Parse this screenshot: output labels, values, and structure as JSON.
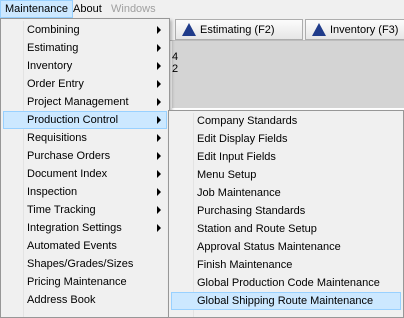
{
  "menubar": {
    "items": [
      {
        "label": "Maintenance",
        "state": "open"
      },
      {
        "label": "About",
        "state": "normal"
      },
      {
        "label": "Windows",
        "state": "disabled"
      }
    ]
  },
  "toolbar": {
    "estimating_label": "Estimating (F2)",
    "inventory_label": "Inventory (F3)",
    "panel_numbers": [
      "4",
      "2"
    ]
  },
  "maintenance_menu": {
    "items": [
      {
        "label": "Combining",
        "submenu": true
      },
      {
        "label": "Estimating",
        "submenu": true
      },
      {
        "label": "Inventory",
        "submenu": true
      },
      {
        "label": "Order Entry",
        "submenu": true
      },
      {
        "label": "Project Management",
        "submenu": true
      },
      {
        "label": "Production Control",
        "submenu": true,
        "highlighted": true
      },
      {
        "label": "Requisitions",
        "submenu": true
      },
      {
        "label": "Purchase Orders",
        "submenu": true
      },
      {
        "label": "Document Index",
        "submenu": true
      },
      {
        "label": "Inspection",
        "submenu": true
      },
      {
        "label": "Time Tracking",
        "submenu": true
      },
      {
        "label": "Integration Settings",
        "submenu": true
      },
      {
        "label": "Automated Events",
        "submenu": false
      },
      {
        "label": "Shapes/Grades/Sizes",
        "submenu": false
      },
      {
        "label": "Pricing Maintenance",
        "submenu": false
      },
      {
        "label": "Address Book",
        "submenu": false
      }
    ]
  },
  "production_control_submenu": {
    "items": [
      {
        "label": "Company Standards"
      },
      {
        "label": "Edit Display Fields"
      },
      {
        "label": "Edit Input Fields"
      },
      {
        "label": "Menu Setup"
      },
      {
        "label": "Job Maintenance"
      },
      {
        "label": "Purchasing Standards"
      },
      {
        "label": "Station and Route Setup"
      },
      {
        "label": "Approval Status Maintenance"
      },
      {
        "label": "Finish Maintenance"
      },
      {
        "label": "Global Production Code Maintenance"
      },
      {
        "label": "Global Shipping Route Maintenance",
        "highlighted": true
      }
    ]
  },
  "colors": {
    "highlight_bg": "#cce8ff",
    "highlight_border": "#99d1ff",
    "menu_bg": "#f0f0f0",
    "icon_blue": "#1f3b8a"
  }
}
